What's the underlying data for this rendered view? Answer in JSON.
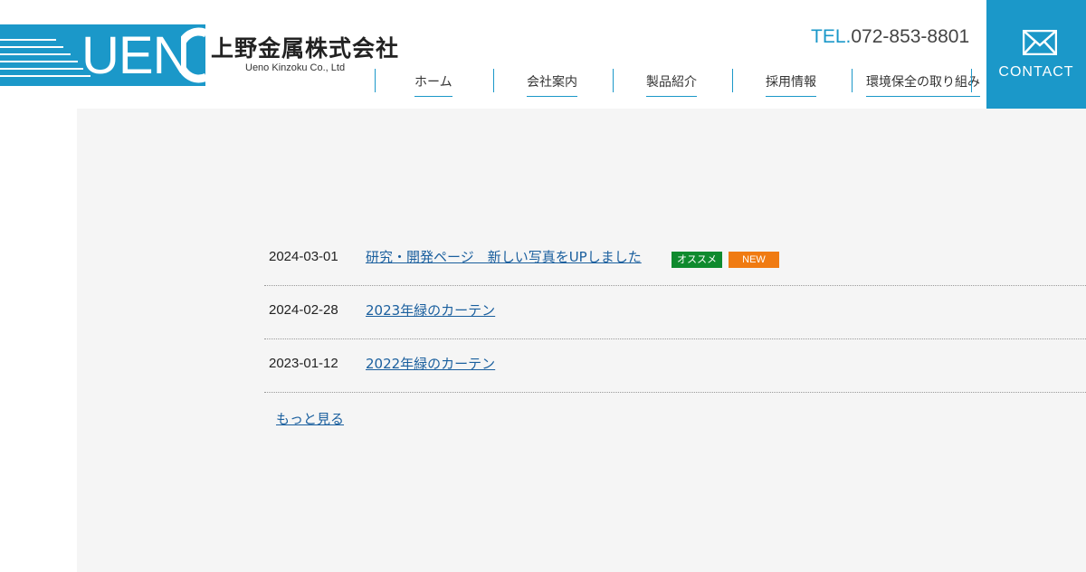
{
  "header": {
    "logo_text": "UEN",
    "company_name_jp": "上野金属株式会社",
    "company_name_en": "Ueno Kinzoku Co., Ltd",
    "tel_prefix": "TEL.",
    "tel_number": "072-853-8801",
    "contact_label": "CONTACT",
    "contact_icon": "mail-icon",
    "brand_color": "#1b98c9"
  },
  "nav": {
    "items": [
      {
        "label": "ホーム"
      },
      {
        "label": "会社案内"
      },
      {
        "label": "製品紹介"
      },
      {
        "label": "採用情報"
      },
      {
        "label": "環境保全の取り組み"
      }
    ]
  },
  "news": {
    "items": [
      {
        "date": "2024-03-01",
        "title": "研究・開発ページ　新しい写真をUPしました",
        "badges": [
          "オススメ",
          "NEW"
        ]
      },
      {
        "date": "2024-02-28",
        "title": "2023年緑のカーテン"
      },
      {
        "date": "2023-01-12",
        "title": "2022年緑のカーテン"
      }
    ],
    "more_label": "もっと見る"
  },
  "colors": {
    "recommend_badge": "#0f8a2e",
    "new_badge": "#f07b12",
    "link": "#1a5f9e",
    "main_bg": "#f5f5f5"
  }
}
